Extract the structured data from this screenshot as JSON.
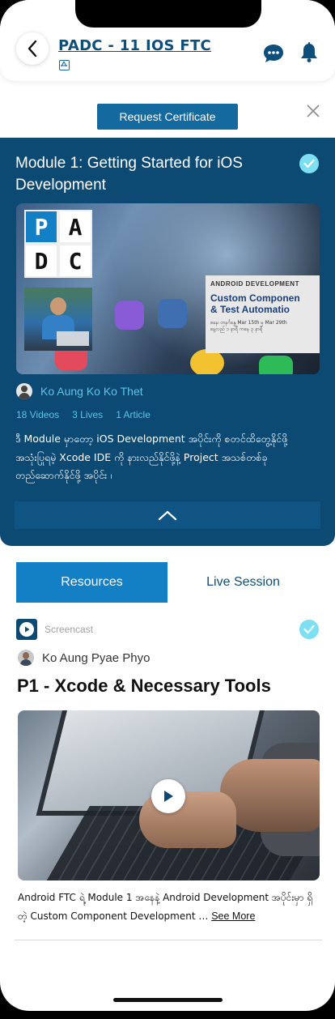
{
  "header": {
    "title": "PADC - 11 IOS FTC",
    "back_icon": "chevron-left-icon",
    "sub_icon": "app-store-icon",
    "chat_icon": "chat-bubble-icon",
    "bell_icon": "bell-icon"
  },
  "certificate": {
    "button_label": "Request Certificate",
    "close_icon": "close-icon"
  },
  "module": {
    "title": "Module 1: Getting Started for iOS Development",
    "completed_icon": "check-circle-icon",
    "padc_letters": [
      "P",
      "A",
      "D",
      "C"
    ],
    "card": {
      "heading": "ANDROID DEVELOPMENT",
      "title_line1": "Custom Componen",
      "title_line2": "& Test Automatio",
      "schedule_line1": "စနေ၊ တနင်္ဂနွေ Mar 15th မှ Mar 29th",
      "schedule_line2": "နေ့လည် ၁ နာရီ ကနေ ၃ နာရီ"
    },
    "author": "Ko Aung Ko Ko Thet",
    "stats": {
      "videos": "18 Videos",
      "lives": "3 Lives",
      "articles": "1 Article"
    },
    "description": "ဒီ Module မှာတော့ iOS Development အပိုင်းကို စတင်ထိတွေ့နိုင်ဖို့ အသုံးပြုရမဲ့ Xcode IDE ကို နားလည်နိုင်ဖို့နဲ့ Project အသစ်တစ်ခု တည်ဆောက်နိုင်ဖို့ အပိုင်း ၊",
    "collapse_icon": "chevron-up-icon"
  },
  "tabs": [
    {
      "label": "Resources",
      "active": true
    },
    {
      "label": "Live Session",
      "active": false
    }
  ],
  "resource": {
    "type_label": "Screencast",
    "type_icon": "play-circle-icon",
    "completed_icon": "check-circle-icon",
    "presenter": "Ko Aung Pyae Phyo",
    "title": "P1 - Xcode & Necessary Tools",
    "play_icon": "play-icon",
    "description": "Android FTC ရဲ့ Module 1 အနေနဲ့ Android Development အပိုင်းမှာ ရှိတဲ့ Custom Component Development …",
    "see_more": "See More"
  },
  "colors": {
    "brand_dark": "#0c4a74",
    "brand_button": "#14699f",
    "accent_cyan": "#7de0f2",
    "tab_active": "#1380c6",
    "link_cyan": "#5bc5e6"
  }
}
